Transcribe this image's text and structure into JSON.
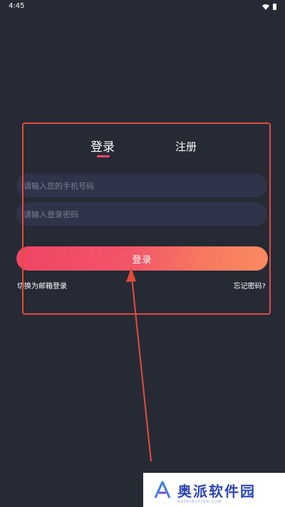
{
  "status_bar": {
    "time": "4:45"
  },
  "tabs": {
    "login": "登录",
    "register": "注册"
  },
  "form": {
    "phone_placeholder": "请输入您的手机号码",
    "password_placeholder": "请输入登录密码",
    "login_button": "登录",
    "switch_email": "切换为邮箱登录",
    "forgot_password": "忘记密码?"
  },
  "watermark": {
    "brand": "奥派软件园",
    "sub": "AUPAIRUTION.COM"
  },
  "colors": {
    "background": "#262a35",
    "accent": "#f04a66",
    "button_gradient_end": "#f98a60",
    "annotation": "#e44b3a",
    "watermark_brand": "#2e46b8"
  },
  "icons": [
    "wifi-icon",
    "battery-icon",
    "watermark-logo-icon"
  ]
}
